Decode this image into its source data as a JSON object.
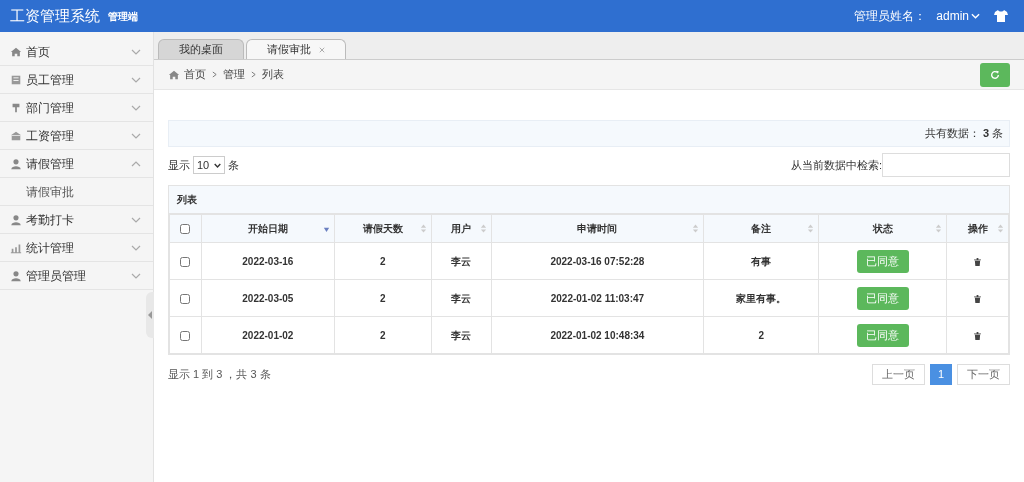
{
  "header": {
    "title": "工资管理系统",
    "subtitle": "管理端",
    "admin_label": "管理员姓名：",
    "admin_name": "admin"
  },
  "sidebar": {
    "items": [
      {
        "kind": "home",
        "label": "首页",
        "expanded": false
      },
      {
        "kind": "list",
        "label": "员工管理",
        "expanded": false
      },
      {
        "kind": "pin",
        "label": "部门管理",
        "expanded": false
      },
      {
        "kind": "bank",
        "label": "工资管理",
        "expanded": false
      },
      {
        "kind": "user",
        "label": "请假管理",
        "expanded": true,
        "children": [
          {
            "label": "请假审批"
          }
        ]
      },
      {
        "kind": "user",
        "label": "考勤打卡",
        "expanded": false
      },
      {
        "kind": "chart",
        "label": "统计管理",
        "expanded": false
      },
      {
        "kind": "user",
        "label": "管理员管理",
        "expanded": false
      }
    ]
  },
  "tabs": [
    {
      "label": "我的桌面",
      "selected": false,
      "closable": false
    },
    {
      "label": "请假审批",
      "selected": true,
      "closable": true
    }
  ],
  "breadcrumb": [
    "首页",
    "管理",
    "列表"
  ],
  "summary": {
    "label": "共有数据：",
    "count": "3",
    "unit": "条"
  },
  "length_menu": {
    "prefix": "显示",
    "value": "10",
    "suffix": "条"
  },
  "search": {
    "label": "从当前数据中检索:"
  },
  "table": {
    "caption": "列表",
    "select_all_checked": false,
    "columns": [
      {
        "label": "开始日期",
        "sorted": true
      },
      {
        "label": "请假天数",
        "sorted": false
      },
      {
        "label": "用户",
        "sorted": false
      },
      {
        "label": "申请时间",
        "sorted": false
      },
      {
        "label": "备注",
        "sorted": false
      },
      {
        "label": "状态",
        "sorted": false
      },
      {
        "label": "操作",
        "sorted": false
      }
    ],
    "rows": [
      {
        "checked": false,
        "start": "2022-03-16",
        "days": "2",
        "user": "李云",
        "time": "2022-03-16 07:52:28",
        "note": "有事",
        "status": "已同意"
      },
      {
        "checked": false,
        "start": "2022-03-05",
        "days": "2",
        "user": "李云",
        "time": "2022-01-02 11:03:47",
        "note": "家里有事。",
        "status": "已同意"
      },
      {
        "checked": false,
        "start": "2022-01-02",
        "days": "2",
        "user": "李云",
        "time": "2022-01-02 10:48:34",
        "note": "2",
        "status": "已同意"
      }
    ]
  },
  "info": "显示 1 到 3 ，共 3 条",
  "pagination": {
    "prev": "上一页",
    "pages": [
      {
        "label": "1",
        "selected": true
      }
    ],
    "next": "下一页"
  }
}
